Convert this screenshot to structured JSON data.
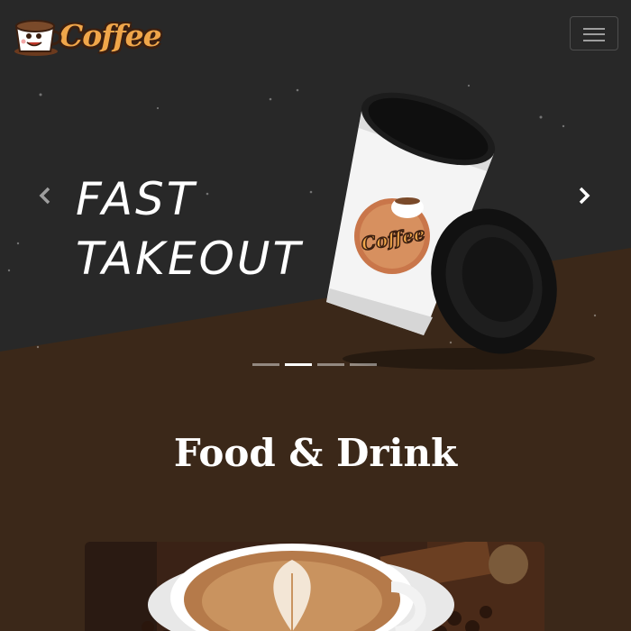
{
  "navbar": {
    "brand_text": "Coffee",
    "toggler_icon": "hamburger-icon"
  },
  "carousel": {
    "slides": [
      {
        "headline_line1": "FAST",
        "headline_line2": "TAKEOUT"
      }
    ],
    "prev_icon": "chevron-left-icon",
    "next_icon": "chevron-right-icon",
    "indicator_count": 4,
    "active_index": 1
  },
  "section": {
    "title": "Food & Drink"
  },
  "colors": {
    "dark_bg": "#2a2a2a",
    "brown_bg": "#3b2819",
    "brand_orange": "#f0a64a",
    "text": "#ffffff"
  }
}
